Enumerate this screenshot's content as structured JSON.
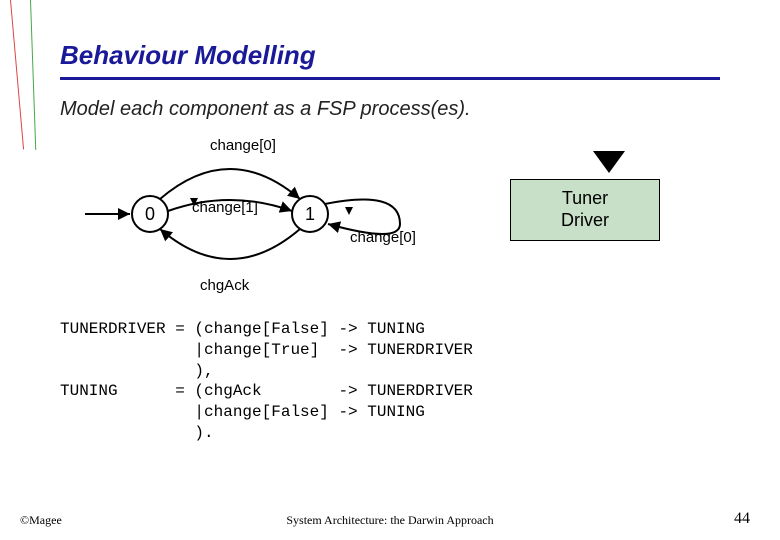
{
  "title": "Behaviour Modelling",
  "subtitle": "Model each component as a FSP process(es).",
  "diagram": {
    "state0": "0",
    "state1": "1",
    "top_label": "change[0]",
    "mid_label": "change[1]",
    "right_label": "change[0]",
    "bottom_label": "chgAck"
  },
  "tuner_box": {
    "line1": "Tuner",
    "line2": "Driver"
  },
  "code": "TUNERDRIVER = (change[False] -> TUNING\n              |change[True]  -> TUNERDRIVER\n              ),\nTUNING      = (chgAck        -> TUNERDRIVER\n              |change[False] -> TUNING\n              ).",
  "footer": {
    "left": "©Magee",
    "center": "System Architecture: the Darwin Approach",
    "page": "44"
  }
}
